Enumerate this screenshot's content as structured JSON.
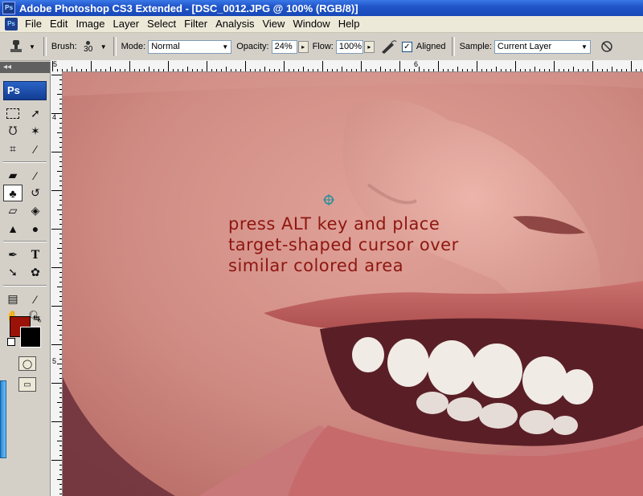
{
  "window": {
    "title": "Adobe Photoshop CS3 Extended - [DSC_0012.JPG @ 100% (RGB/8)]",
    "app_icon": "Ps"
  },
  "menu": {
    "items": [
      "File",
      "Edit",
      "Image",
      "Layer",
      "Select",
      "Filter",
      "Analysis",
      "View",
      "Window",
      "Help"
    ]
  },
  "options": {
    "brush_label": "Brush:",
    "brush_size": "30",
    "mode_label": "Mode:",
    "mode_value": "Normal",
    "opacity_label": "Opacity:",
    "opacity_value": "24%",
    "flow_label": "Flow:",
    "flow_value": "100%",
    "aligned_label": "Aligned",
    "aligned_checked": true,
    "sample_label": "Sample:",
    "sample_value": "Current Layer"
  },
  "toolbox": {
    "logo": "Ps",
    "collapse": "◂◂",
    "foreground_color": "#9b1308",
    "background_color": "#000000",
    "active_tool": "clone-stamp-tool"
  },
  "rulers": {
    "top_numbers": [
      "5",
      "6"
    ],
    "left_numbers": [
      "4",
      "5"
    ]
  },
  "canvas": {
    "instruction_lines": [
      "press ALT key and place",
      "target-shaped cursor over",
      "similar colored area"
    ],
    "text_color": "#8e1610"
  }
}
